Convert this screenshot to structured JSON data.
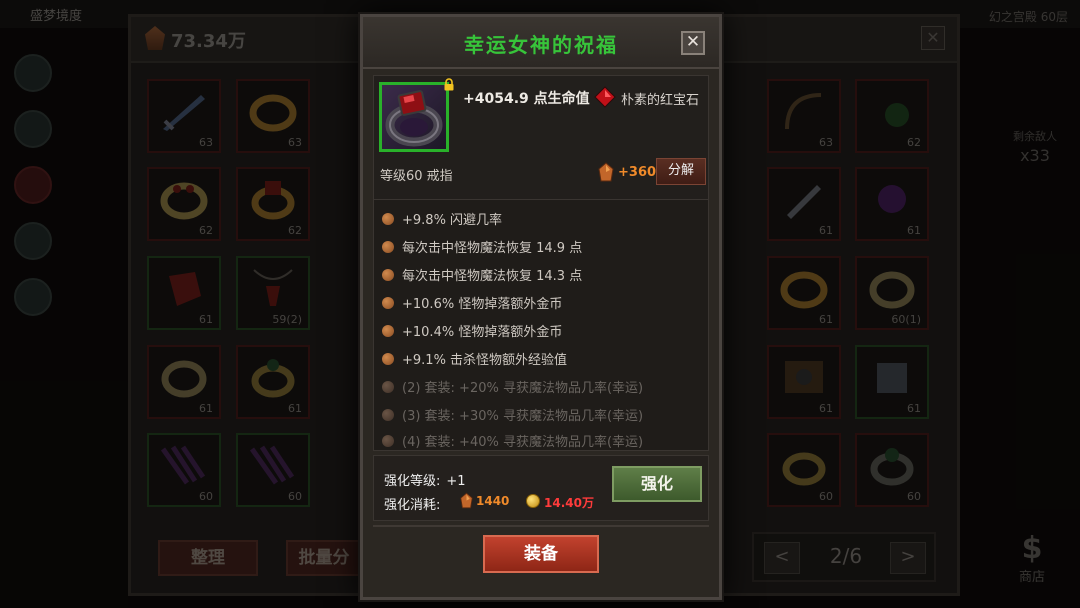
{
  "background": {
    "top_title": "盛梦境度",
    "right_title": "幻之宫殿 60层",
    "gold_amount": "73.34万",
    "remaining_label": "剩余敌人",
    "remaining_count": "x33",
    "sort_label": "整理",
    "batch_label": "批量分",
    "page_label": "2/6",
    "prev_arrow": "<",
    "next_arrow": ">",
    "shop_icon": "$",
    "shop_label": "商店",
    "close_glyph": "✕",
    "inventory_levels": [
      "63",
      "63",
      "63",
      "62",
      "62",
      "62",
      "62",
      "61",
      "61",
      "61",
      "61",
      "59(2)",
      "0(1)",
      "61",
      "60(1)",
      "61",
      "61",
      "61",
      "61",
      "60",
      "60",
      "60",
      "60",
      "60",
      "60"
    ]
  },
  "popup": {
    "title": "幸运女神的祝福",
    "close_glyph": "✕",
    "main_stat": "+4054.9 点生命值",
    "gem_name": "朴素的红宝石",
    "item_meta": "等级60  戒指",
    "salvage_value": "+360",
    "salvage_label": "分解",
    "attributes": [
      {
        "text": "+9.8% 闪避几率",
        "active": true
      },
      {
        "text": "每次击中怪物魔法恢复 14.9 点",
        "active": true
      },
      {
        "text": "每次击中怪物魔法恢复 14.3 点",
        "active": true
      },
      {
        "text": "+10.6% 怪物掉落额外金币",
        "active": true
      },
      {
        "text": "+10.4% 怪物掉落额外金币",
        "active": true
      },
      {
        "text": "+9.1% 击杀怪物额外经验值",
        "active": true
      },
      {
        "text": "(2) 套装: +20% 寻获魔法物品几率(幸运)",
        "active": false
      },
      {
        "text": "(3) 套装: +30% 寻获魔法物品几率(幸运)",
        "active": false
      },
      {
        "text": "(4) 套装: +40% 寻获魔法物品几率(幸运)",
        "active": false
      }
    ],
    "enhance_level_label": "强化等级:",
    "enhance_level_value": "+1",
    "enhance_cost_label": "强化消耗:",
    "enhance_ore_cost": "1440",
    "enhance_gold_cost": "14.40万",
    "enhance_button": "强化",
    "equip_button": "装备"
  },
  "colors": {
    "title_green": "#37c43a",
    "rare_border_green": "#29b12a",
    "ore_orange": "#f08a2a",
    "cost_red": "#ff3b3b",
    "equip_red": "#b33521",
    "enhance_green": "#4f6d3a"
  },
  "icons": [
    "lock-icon",
    "ruby-gem-icon",
    "ore-icon",
    "gold-coin-icon",
    "close-icon",
    "ring-item-icon"
  ]
}
